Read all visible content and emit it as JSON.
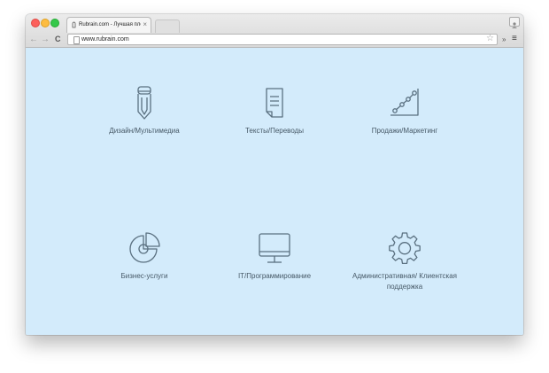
{
  "browser": {
    "tab_title": "Rubrain.com - Лучшая пло",
    "tab_close": "×",
    "url": "www.rubrain.com",
    "nav_back": "←",
    "nav_forward": "→",
    "nav_reload": "C",
    "star": "☆",
    "extensions": "»",
    "menu": "≡"
  },
  "categories": [
    {
      "label": "Дизайн/Мультимедиа",
      "icon": "pencil-icon"
    },
    {
      "label": "Тексты/Переводы",
      "icon": "document-icon"
    },
    {
      "label": "Продажи/Маркетинг",
      "icon": "growth-chart-icon"
    },
    {
      "label": "Бизнес-услуги",
      "icon": "pie-chart-icon"
    },
    {
      "label": "IT/Программирование",
      "icon": "monitor-icon"
    },
    {
      "label": "Административная/ Клиентская поддержка",
      "icon": "gear-icon"
    }
  ],
  "colors": {
    "background": "#d3ebfb",
    "icon_stroke": "#5a7080",
    "text": "#465866"
  }
}
